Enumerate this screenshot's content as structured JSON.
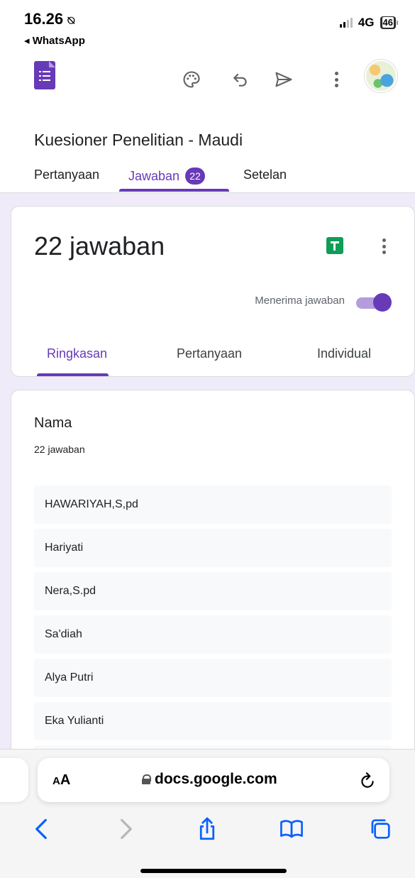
{
  "status_bar": {
    "time": "16.26",
    "back_app": "◂ WhatsApp",
    "network": "4G",
    "battery": "46"
  },
  "form": {
    "title": "Kuesioner Penelitian - Maudi",
    "tabs": [
      {
        "label": "Pertanyaan"
      },
      {
        "label": "Jawaban",
        "badge": "22"
      },
      {
        "label": "Setelan"
      }
    ]
  },
  "summary": {
    "response_count": "22 jawaban",
    "accepting_label": "Menerima jawaban",
    "accepting": true,
    "sub_tabs": [
      {
        "label": "Ringkasan"
      },
      {
        "label": "Pertanyaan"
      },
      {
        "label": "Individual"
      }
    ]
  },
  "question": {
    "title": "Nama",
    "count": "22 jawaban",
    "answers": [
      "HAWARIYAH,S,pd",
      "Hariyati",
      "Nera,S.pd",
      "Sa'diah",
      "Alya Putri",
      "Eka Yulianti"
    ]
  },
  "browser": {
    "aa_label_small": "A",
    "aa_label_large": "A",
    "url": "docs.google.com"
  },
  "colors": {
    "accent": "#673ab7",
    "accent_light": "#b39ddb",
    "page_bg": "#f0ebf8",
    "sheets_green": "#0f9d58",
    "ios_blue": "#0a60ff"
  },
  "icons": [
    "forms-logo-icon",
    "palette-icon",
    "undo-icon",
    "send-icon",
    "more-vert-icon",
    "sheets-icon",
    "lock-icon",
    "reload-icon",
    "back-icon",
    "forward-icon",
    "share-icon",
    "bookmarks-icon",
    "tabs-icon"
  ]
}
